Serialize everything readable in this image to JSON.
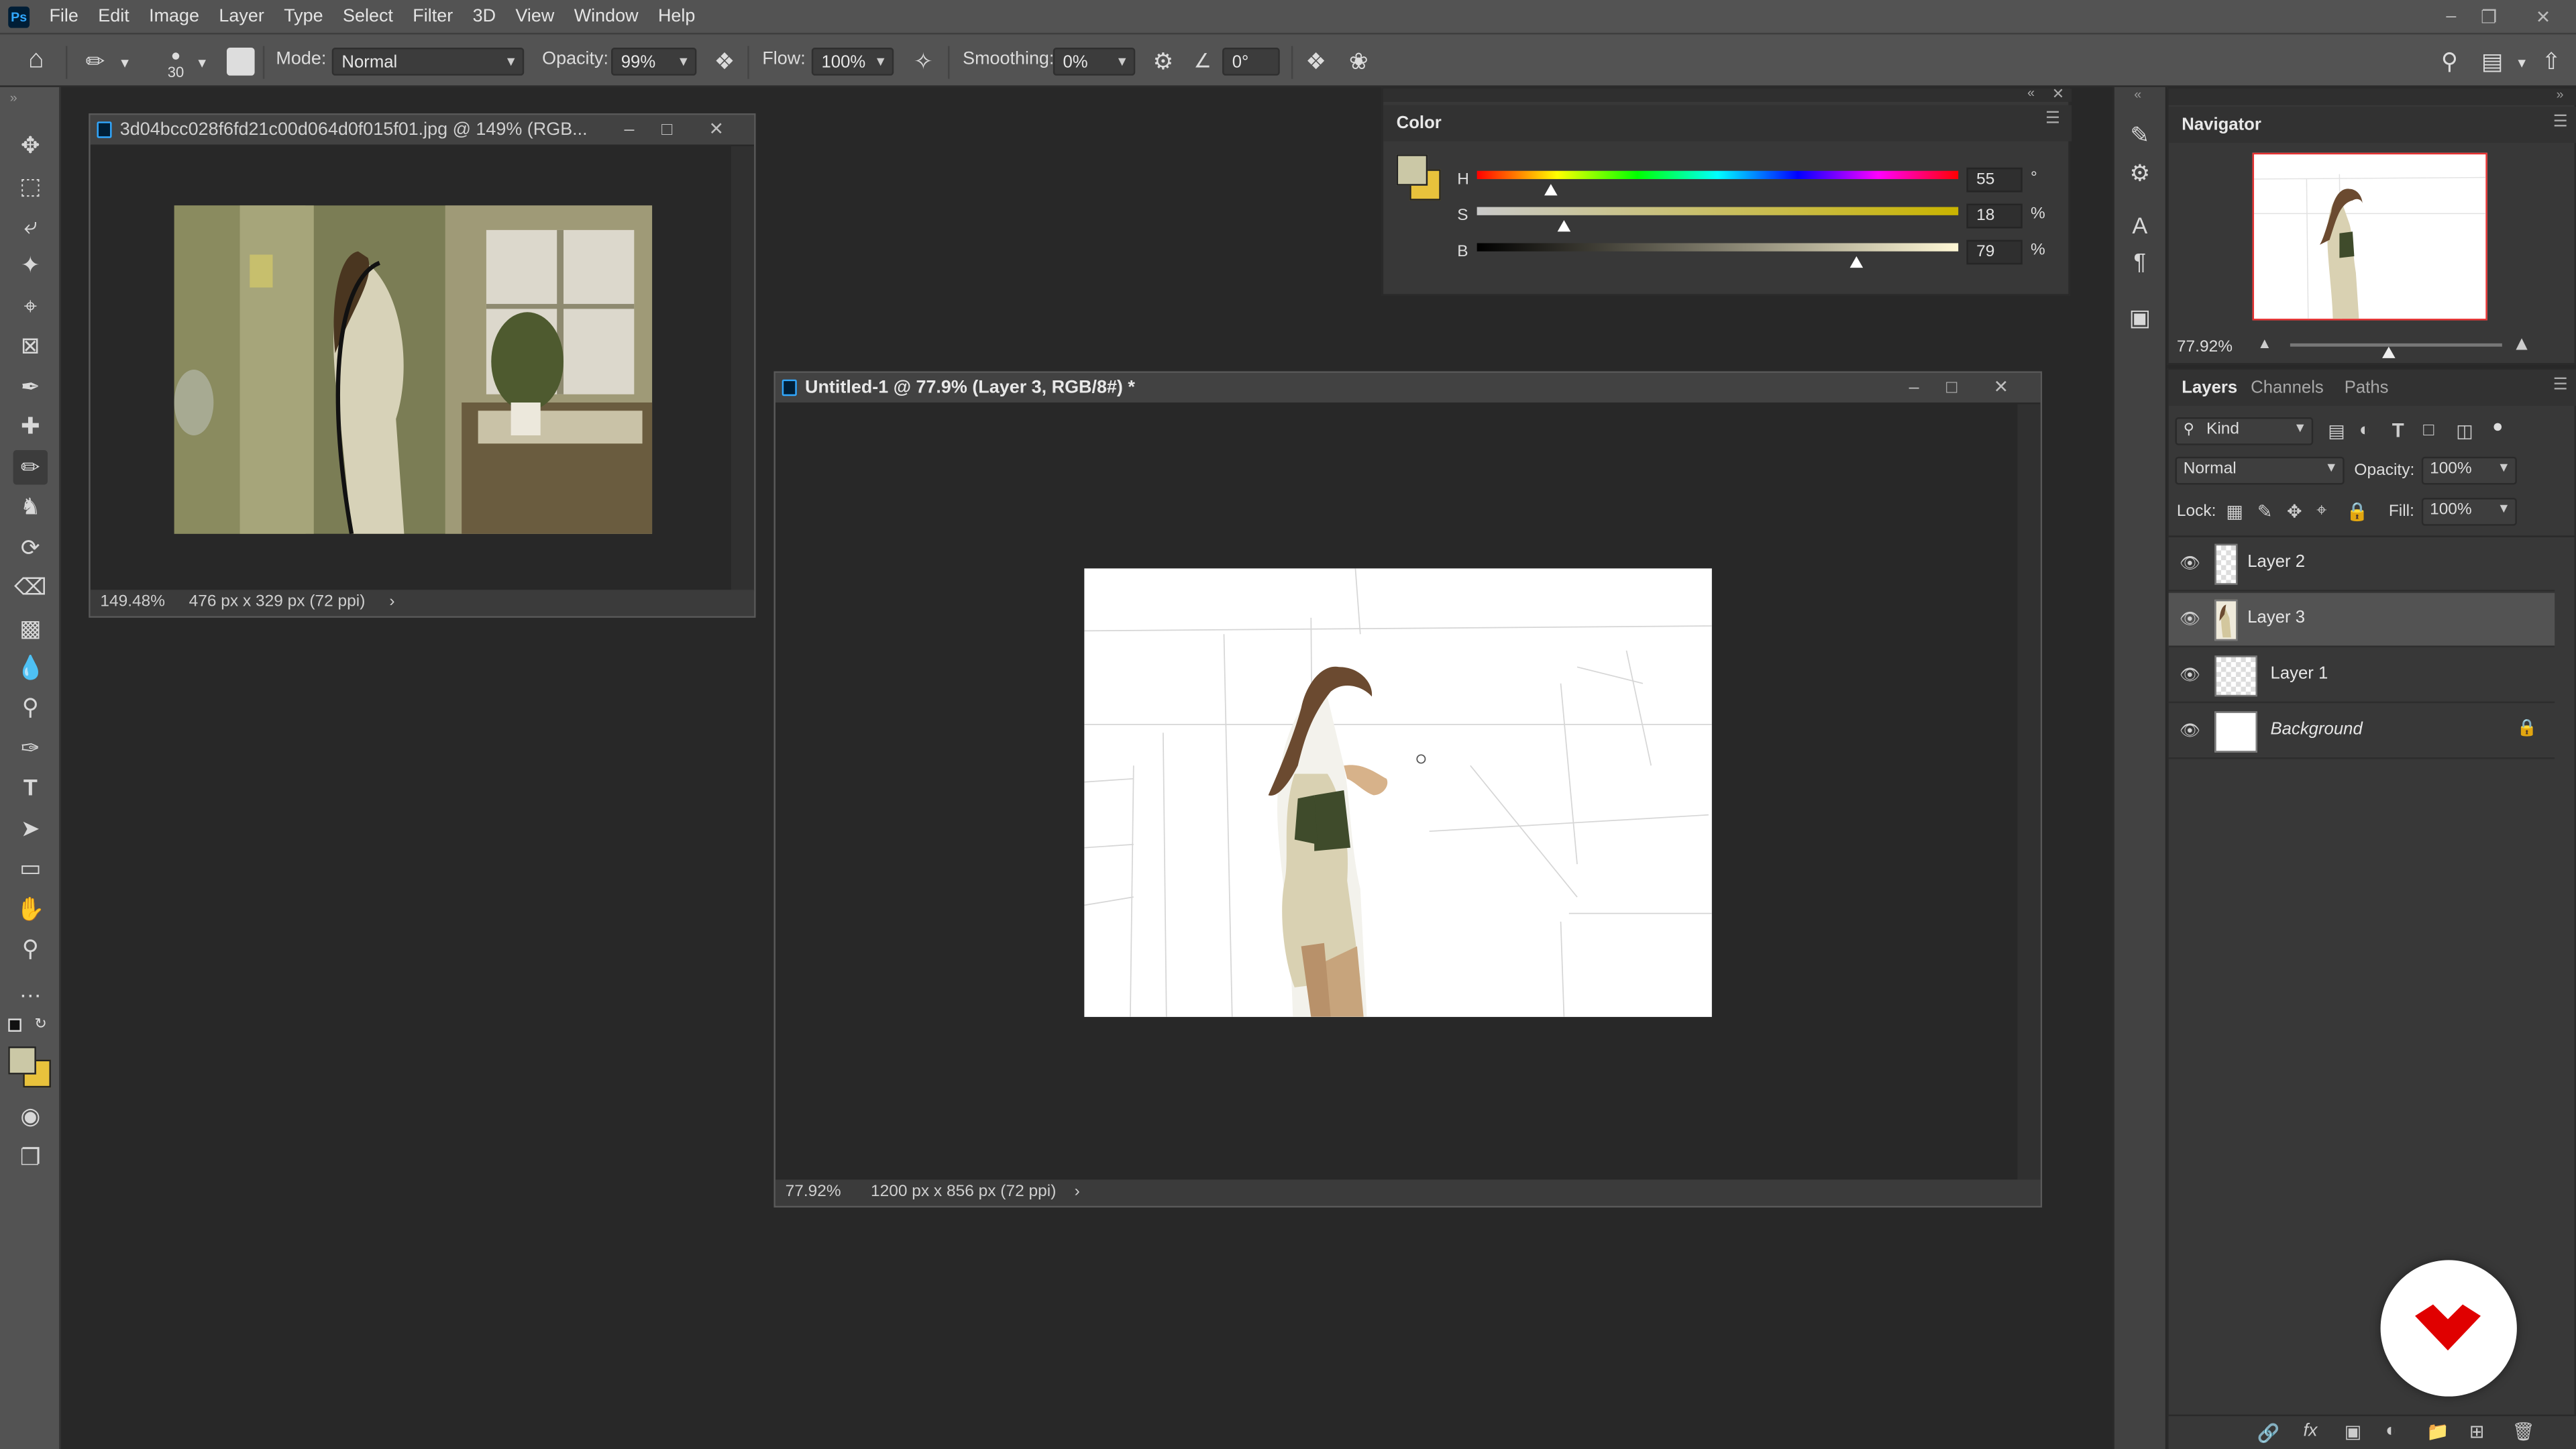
{
  "menu": [
    "File",
    "Edit",
    "Image",
    "Layer",
    "Type",
    "Select",
    "Filter",
    "3D",
    "View",
    "Window",
    "Help"
  ],
  "options": {
    "brush_size": "30",
    "mode_label": "Mode:",
    "mode_value": "Normal",
    "opacity_label": "Opacity:",
    "opacity_value": "99%",
    "flow_label": "Flow:",
    "flow_value": "100%",
    "smoothing_label": "Smoothing:",
    "smoothing_value": "0%",
    "angle_value": "0°"
  },
  "doc1": {
    "title": "3d04bcc028f6fd21c00d064d0f015f01.jpg @ 149% (RGB...",
    "zoom": "149.48%",
    "size": "476 px x 329 px (72 ppi)"
  },
  "doc2": {
    "title": "Untitled-1 @ 77.9% (Layer 3, RGB/8#) *",
    "zoom": "77.92%",
    "size": "1200 px x 856 px (72 ppi)"
  },
  "color_panel": {
    "title": "Color",
    "h_label": "H",
    "h_value": "55",
    "h_unit": "°",
    "s_label": "S",
    "s_value": "18",
    "s_unit": "%",
    "b_label": "B",
    "b_value": "79",
    "b_unit": "%",
    "h": 55,
    "s": 18,
    "b": 79,
    "foreground": "#cbc8a6",
    "background": "#e8c23c"
  },
  "navigator": {
    "title": "Navigator",
    "zoom": "77.92%"
  },
  "layers_panel": {
    "tabs": [
      "Layers",
      "Channels",
      "Paths"
    ],
    "filter_label": "Kind",
    "blend_mode": "Normal",
    "opacity_label": "Opacity:",
    "opacity_value": "100%",
    "lock_label": "Lock:",
    "fill_label": "Fill:",
    "fill_value": "100%",
    "layers": [
      {
        "name": "Layer 2",
        "selected": false,
        "locked": false
      },
      {
        "name": "Layer 3",
        "selected": true,
        "locked": false
      },
      {
        "name": "Layer 1",
        "selected": false,
        "locked": false
      },
      {
        "name": "Background",
        "selected": false,
        "locked": true
      }
    ]
  },
  "colors": {
    "accent": "#31a8ff",
    "logo_red": "#e00000"
  }
}
